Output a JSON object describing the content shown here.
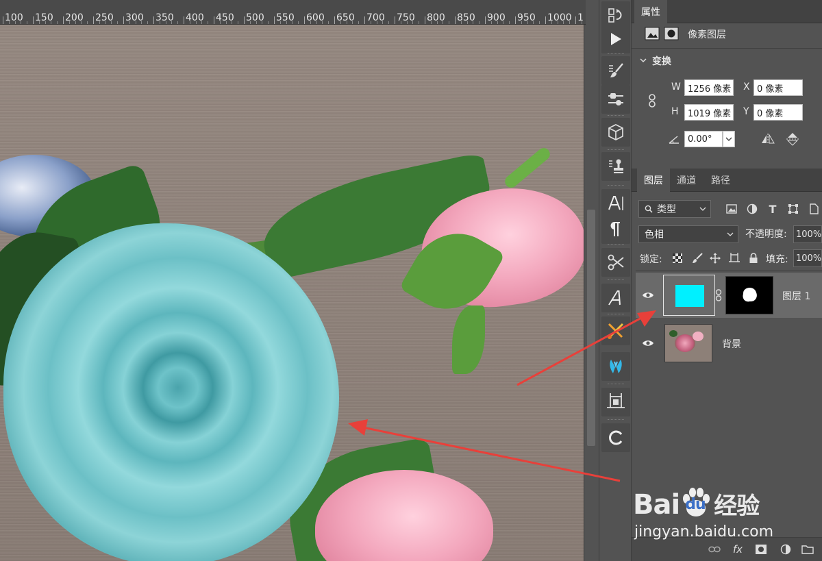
{
  "ruler": {
    "labels": [
      "100",
      "150",
      "200",
      "250",
      "300",
      "350",
      "400",
      "450",
      "500",
      "550",
      "600",
      "650",
      "700",
      "750",
      "800",
      "850",
      "900",
      "950",
      "1000",
      "1"
    ]
  },
  "tools": [
    {
      "icon": "history-brush-icon"
    },
    {
      "icon": "play-icon"
    },
    {
      "icon": "brush-presets-icon"
    },
    {
      "icon": "adjustments-icon"
    },
    {
      "icon": "3d-cube-icon"
    },
    {
      "icon": "clone-stamp-icon"
    },
    {
      "icon": "character-icon"
    },
    {
      "icon": "paragraph-icon"
    },
    {
      "icon": "tools-icon"
    },
    {
      "icon": "glyphs-icon"
    },
    {
      "icon": "brush-settings-icon"
    },
    {
      "icon": "puppet-icon"
    },
    {
      "icon": "artboard-icon"
    },
    {
      "icon": "refresh-icon"
    }
  ],
  "properties": {
    "tab": "属性",
    "type_label": "像素图层",
    "section_title": "变换",
    "w_label": "W",
    "w_value": "1256 像素",
    "h_label": "H",
    "h_value": "1019 像素",
    "x_label": "X",
    "x_value": "0 像素",
    "y_label": "Y",
    "y_value": "0 像素",
    "angle_value": "0.00°"
  },
  "layers_panel": {
    "tabs": [
      "图层",
      "通道",
      "路径"
    ],
    "filter_kind": "类型",
    "blend_mode": "色相",
    "opacity_label": "不透明度:",
    "opacity_value": "100%",
    "lock_label": "锁定:",
    "fill_label": "填充:",
    "fill_value": "100%",
    "layers": [
      {
        "name": "图层 1",
        "visible": true,
        "selected": true,
        "thumb_color": "#00f0ff"
      },
      {
        "name": "背景",
        "visible": true,
        "selected": false
      }
    ]
  },
  "watermark": {
    "brand": "Bai",
    "brand_du": "du",
    "brand_cn": "经验",
    "url": "jingyan.baidu.com"
  },
  "colors": {
    "arrow": "#e8403a",
    "selected_thumb": "#00f0ff",
    "panel_bg": "#535353"
  }
}
